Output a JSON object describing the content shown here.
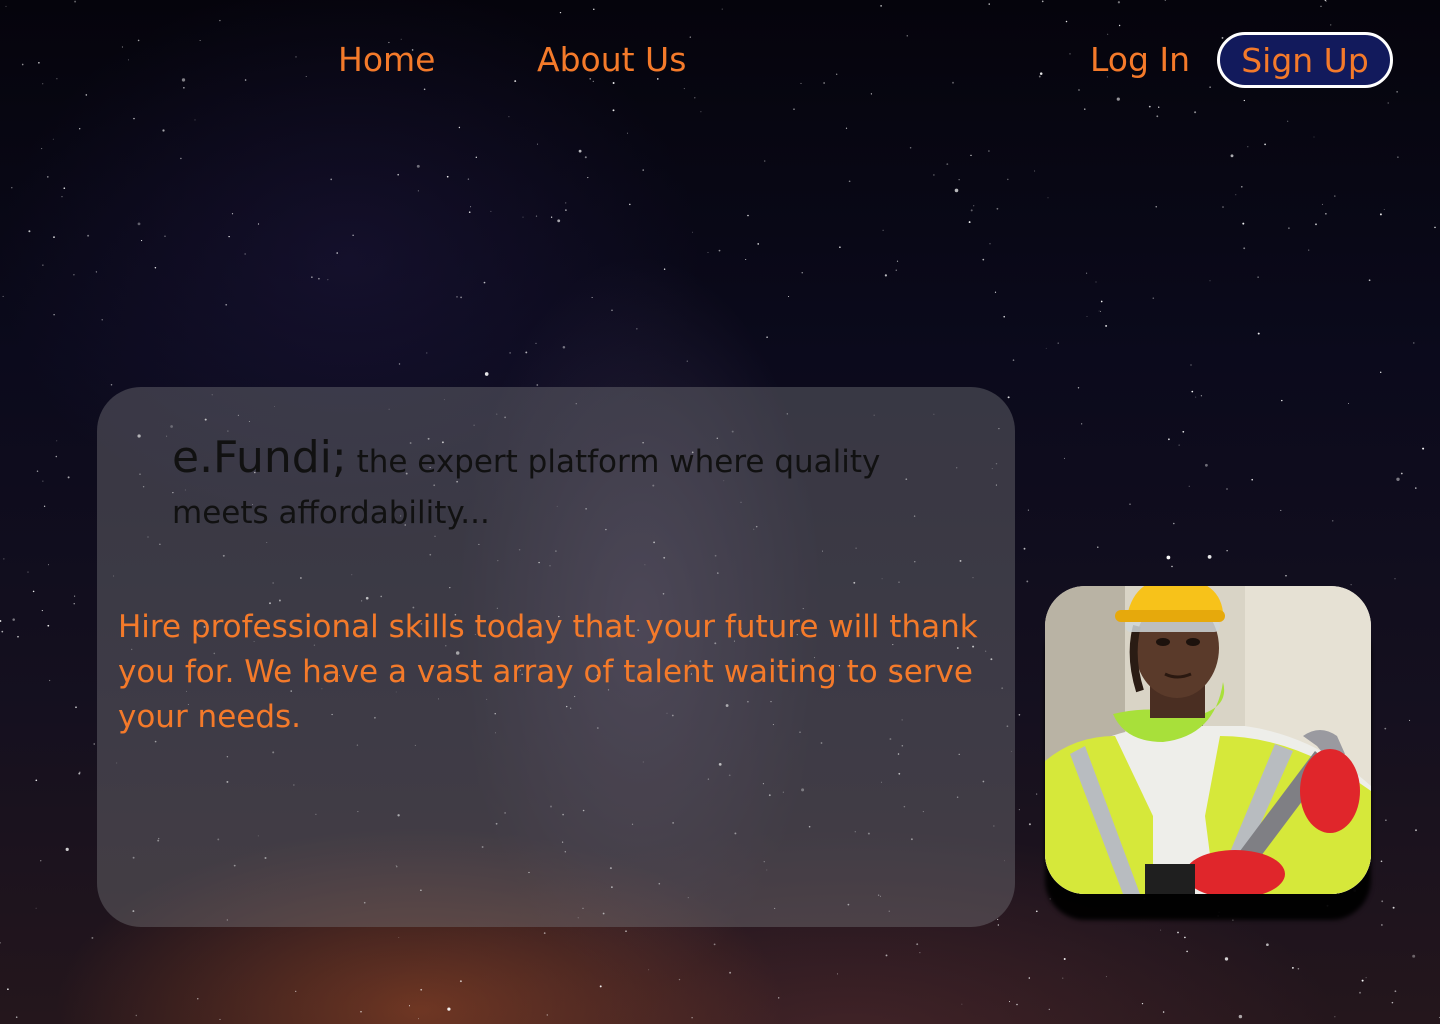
{
  "nav": {
    "home": "Home",
    "about": "About Us",
    "login": "Log In",
    "signup": "Sign Up"
  },
  "hero": {
    "brand": "e.Fundi;",
    "tagline": " the expert platform where quality meets affordability...",
    "description": "Hire professional skills today that your future will thank you for. We have a vast array of talent waiting to serve your needs."
  },
  "icons": {
    "worker_photo": "construction-worker-photo"
  },
  "colors": {
    "accent": "#f47a2a",
    "signup_bg": "#121a5c",
    "signup_border": "#ffffff",
    "background": "#0b0a1c"
  }
}
